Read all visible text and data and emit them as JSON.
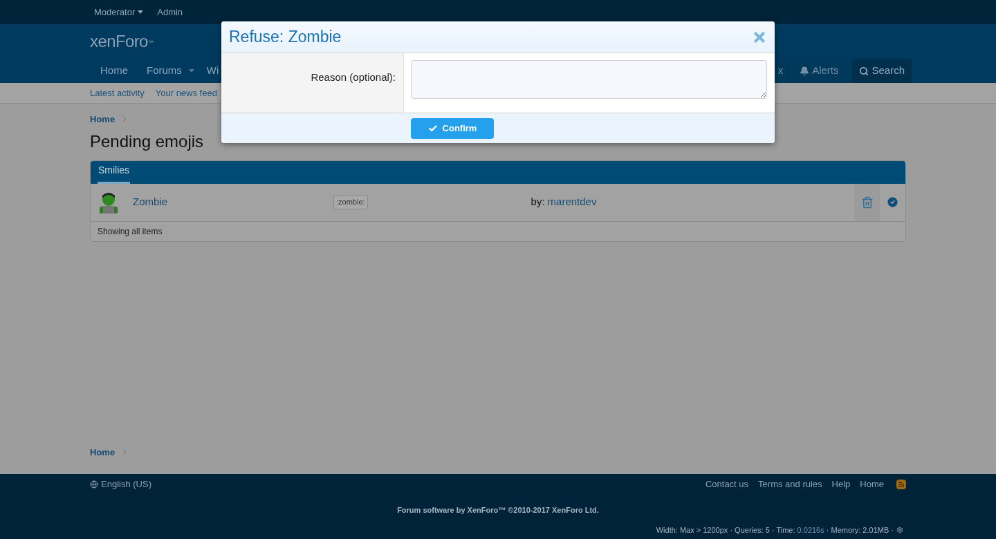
{
  "top_bar": {
    "items": [
      {
        "label": "Moderator",
        "has_menu": true
      },
      {
        "label": "Admin",
        "has_menu": false
      }
    ]
  },
  "header": {
    "logo": "xenForo",
    "logo_mark": "™"
  },
  "nav": {
    "left": [
      {
        "label": "Home",
        "has_menu": false
      },
      {
        "label": "Forums",
        "has_menu": true
      },
      {
        "label": "Wi",
        "has_menu": false
      }
    ],
    "right": [
      {
        "label": "x",
        "kind": "link",
        "selected": false
      },
      {
        "label": "Alerts",
        "kind": "alerts",
        "selected": false
      },
      {
        "label": "Search",
        "kind": "search",
        "selected": true
      }
    ]
  },
  "sub_nav": [
    "Latest activity",
    "Your news feed"
  ],
  "breadcrumb": "Home",
  "page_title": "Pending emojis",
  "block": {
    "tabs": [
      {
        "label": "Smilies",
        "selected": true
      }
    ],
    "rows": [
      {
        "name": "Zombie",
        "code": ":zombie:",
        "by_label": "by:",
        "author": "marentdev"
      }
    ],
    "footer": "Showing all items"
  },
  "bottom_breadcrumb": "Home",
  "footer": {
    "language": "English (US)",
    "links": [
      "Contact us",
      "Terms and rules",
      "Help",
      "Home"
    ],
    "copyright": "Forum software by XenForo™ ©2010-2017 XenForo Ltd.",
    "debug": [
      {
        "text": "Width: Max > 1200px · Queries: 5 · Time: ",
        "kind": "plain"
      },
      {
        "text": "0.0216s",
        "kind": "link"
      },
      {
        "text": " · Memory: 2.01MB ·",
        "kind": "plain"
      }
    ]
  },
  "dialog": {
    "title": "Refuse: Zombie",
    "field_label": "Reason (optional):",
    "button": "Confirm"
  }
}
